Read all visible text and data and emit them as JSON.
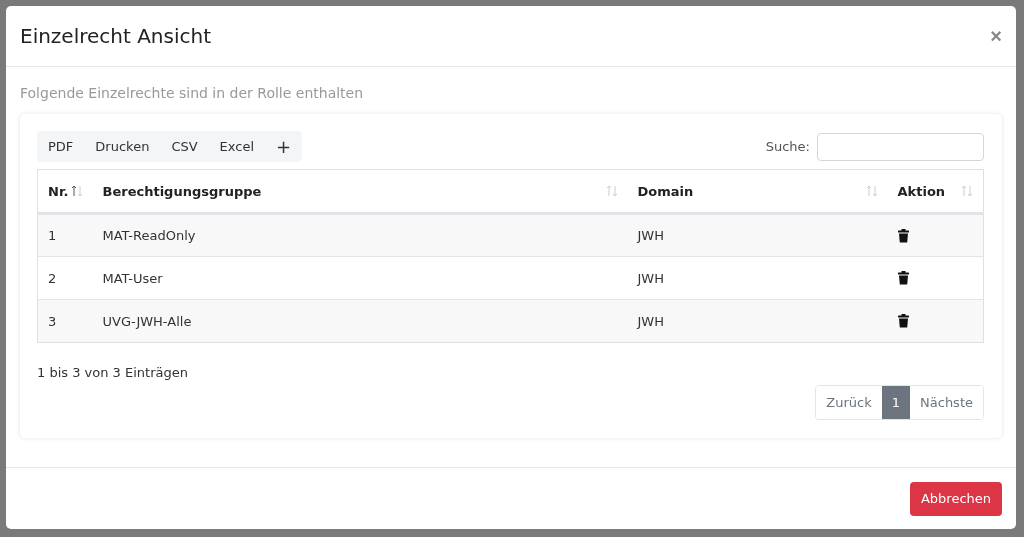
{
  "dialog": {
    "title": "Einzelrecht Ansicht",
    "close": "×"
  },
  "subtitle": "Folgende Einzelrechte sind in der Rolle enthalten",
  "export_buttons": [
    "PDF",
    "Drucken",
    "CSV",
    "Excel",
    "+"
  ],
  "search": {
    "label": "Suche:"
  },
  "table": {
    "columns": [
      {
        "label": "Nr.",
        "sorted_ascending": true
      },
      {
        "label": "Berechtigungsgruppe",
        "sorted_ascending": false
      },
      {
        "label": "Domain",
        "sorted_ascending": false
      },
      {
        "label": "Aktion",
        "sorted_ascending": false
      }
    ],
    "rows": [
      {
        "nr": "1",
        "group": "MAT-ReadOnly",
        "domain": "JWH"
      },
      {
        "nr": "2",
        "group": "MAT-User",
        "domain": "JWH"
      },
      {
        "nr": "3",
        "group": "UVG-JWH-Alle",
        "domain": "JWH"
      }
    ]
  },
  "info": "1 bis 3 von 3 Einträgen",
  "pagination": {
    "previous": "Zurück",
    "pages": [
      {
        "label": "1",
        "selected": true
      }
    ],
    "next": "Nächste"
  },
  "footer_button": "Abbrechen"
}
